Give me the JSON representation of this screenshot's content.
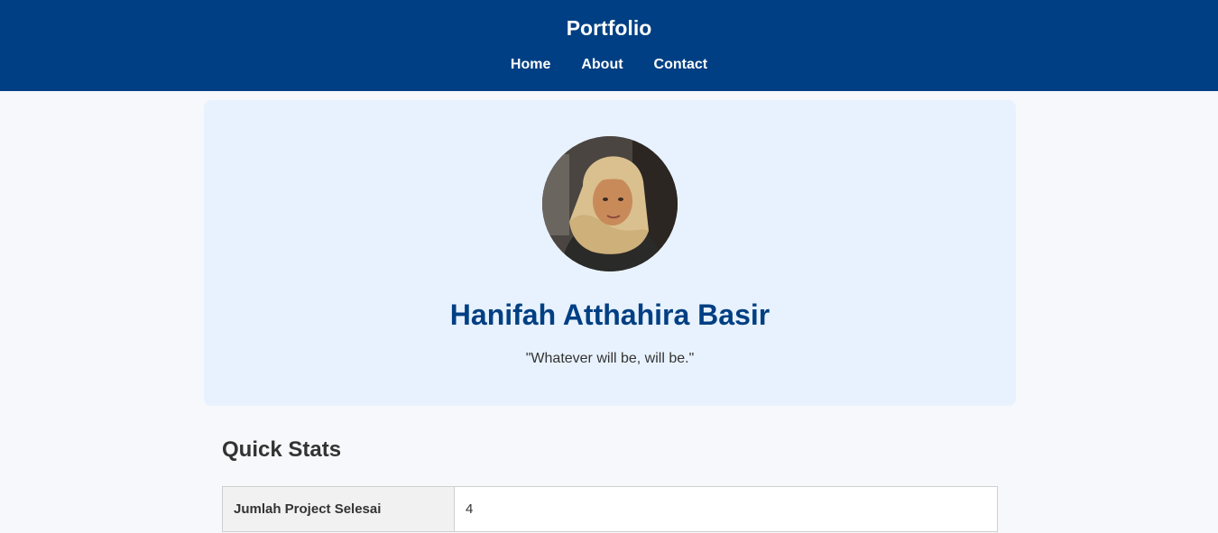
{
  "header": {
    "title": "Portfolio",
    "nav": [
      {
        "label": "Home"
      },
      {
        "label": "About"
      },
      {
        "label": "Contact"
      }
    ]
  },
  "hero": {
    "name": "Hanifah Atthahira Basir",
    "quote": "\"Whatever will be, will be.\"",
    "avatar_alt": "profile photo"
  },
  "stats": {
    "title": "Quick Stats",
    "rows": [
      {
        "label": "Jumlah Project Selesai",
        "value": "4"
      }
    ]
  },
  "colors": {
    "header_bg": "#003f83",
    "hero_bg": "#e8f2fe",
    "name_color": "#003f83",
    "page_bg": "#f6f8fb"
  }
}
